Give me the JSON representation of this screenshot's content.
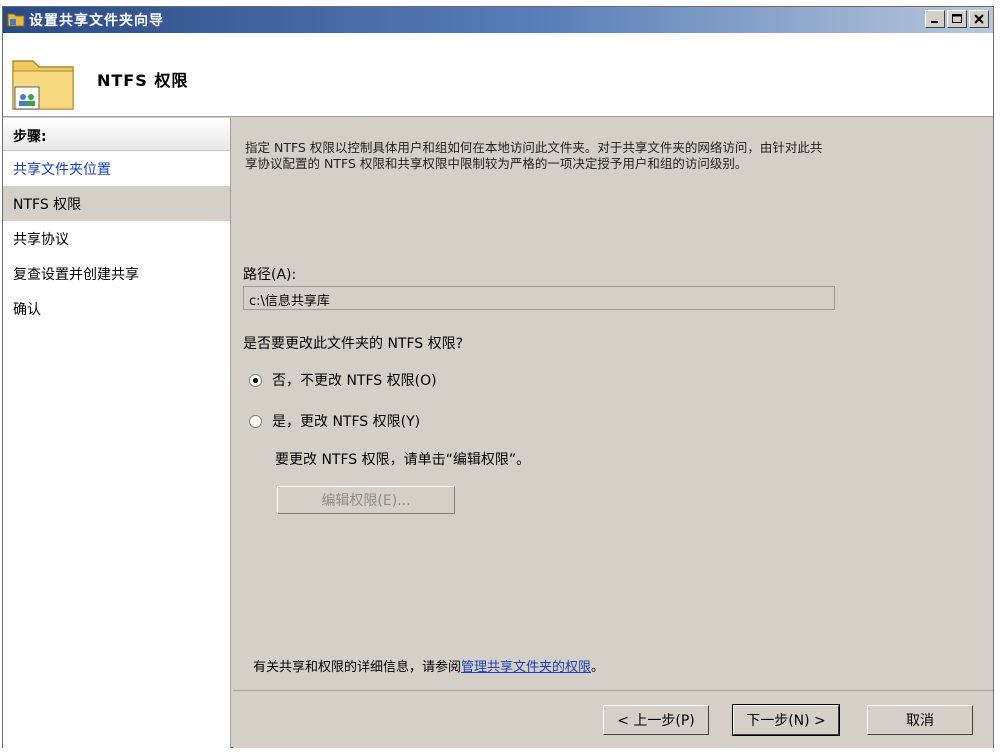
{
  "window": {
    "title": "设置共享文件夹向导",
    "page_title": "NTFS 权限"
  },
  "steps": {
    "header": "步骤:",
    "items": [
      {
        "label": "共享文件夹位置"
      },
      {
        "label": "NTFS 权限"
      },
      {
        "label": "共享协议"
      },
      {
        "label": "复查设置并创建共享"
      },
      {
        "label": "确认"
      }
    ]
  },
  "content": {
    "description": "指定 NTFS 权限以控制具体用户和组如何在本地访问此文件夹。对于共享文件夹的网络访问，由针对此共享协议配置的 NTFS 权限和共享权限中限制较为严格的一项决定授予用户和组的访问级别。",
    "path_label": "路径(A):",
    "path_value": "c:\\信息共享库",
    "question": "是否要更改此文件夹的 NTFS 权限?",
    "option_no": "否，不更改 NTFS 权限(O)",
    "option_yes": "是，更改 NTFS 权限(Y)",
    "hint": "要更改 NTFS 权限，请单击“编辑权限”。",
    "edit_button": "编辑权限(E)...",
    "info_text": "有关共享和权限的详细信息，请参阅",
    "info_link": "管理共享文件夹的权限",
    "info_end": "。"
  },
  "footer": {
    "back": "< 上一步(P)",
    "next": "下一步(N) >",
    "cancel": "取消"
  },
  "icons": {
    "title_icon": "folder-share-icon",
    "header_icon": "shared-folder-icon"
  },
  "colors": {
    "link": "#1a3fb8",
    "titlebar": "#2a4a86"
  }
}
